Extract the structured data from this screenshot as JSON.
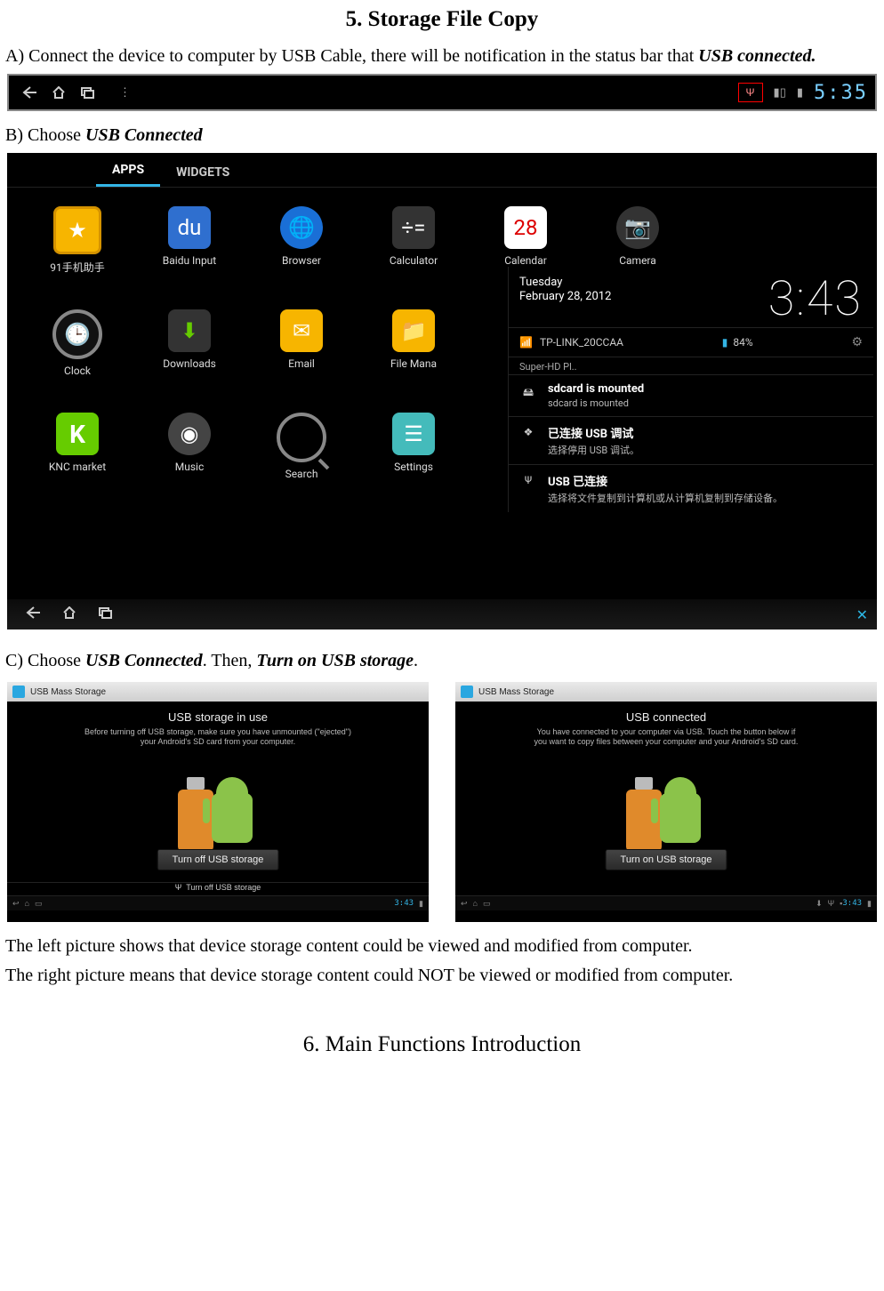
{
  "section5": {
    "title": "5. Storage File Copy",
    "stepA_pre": "A) Connect the device to computer by USB Cable, there will be notification in the status bar that ",
    "stepA_bold": "USB connected.",
    "stepB_pre": "B) Choose ",
    "stepB_bold": "USB Connected",
    "stepC_pre": "C) Choose ",
    "stepC_bold1": "USB Connected",
    "stepC_mid": ". Then, ",
    "stepC_bold2": "Turn on USB storage",
    "stepC_end": ".",
    "explain_left": "The left picture shows that device storage content could be viewed and modified from computer.",
    "explain_right": "The right picture means that device storage content could NOT be viewed or modified from computer."
  },
  "section6": {
    "title": "6. Main Functions Introduction"
  },
  "statusbar": {
    "clock": "5:35",
    "dots": "⋮"
  },
  "tablet": {
    "tabs": {
      "apps": "APPS",
      "widgets": "WIDGETS"
    },
    "apps": [
      "91手机助手",
      "Baidu Input",
      "Browser",
      "Calculator",
      "Calendar",
      "Camera",
      "Clock",
      "Downloads",
      "Email",
      "File Mana",
      "",
      "",
      "KNC market",
      "Music",
      "Search",
      "Settings",
      "",
      ""
    ],
    "notif": {
      "weekday": "Tuesday",
      "date": "February 28, 2012",
      "clock": "3:43",
      "wifi_name": "TP-LINK_20CCAA",
      "battery": "84%",
      "section_label": "Super-HD Pl..",
      "items": [
        {
          "icon": "🖴",
          "title": "sdcard is mounted",
          "sub": "sdcard is mounted"
        },
        {
          "icon": "❖",
          "title": "已连接 USB 调试",
          "sub": "选择停用 USB 调试。"
        },
        {
          "icon": "Ψ",
          "title": "USB 已连接",
          "sub": "选择将文件复制到计算机或从计算机复制到存储设备。"
        }
      ]
    }
  },
  "shots": {
    "window_title": "USB Mass Storage",
    "left": {
      "heading": "USB storage in use",
      "subtext": "Before turning off USB storage, make sure you have unmounted (\"ejected\") your Android's SD card from your computer.",
      "button": "Turn off USB storage",
      "syslabel_icon": "Ψ",
      "syslabel": "Turn off USB storage",
      "navclock": "3:43"
    },
    "right": {
      "heading": "USB connected",
      "subtext": "You have connected to your computer via USB. Touch the button below if you want to copy files between your computer and your Android's SD card.",
      "button": "Turn on USB storage",
      "navclock": "3:43"
    }
  }
}
